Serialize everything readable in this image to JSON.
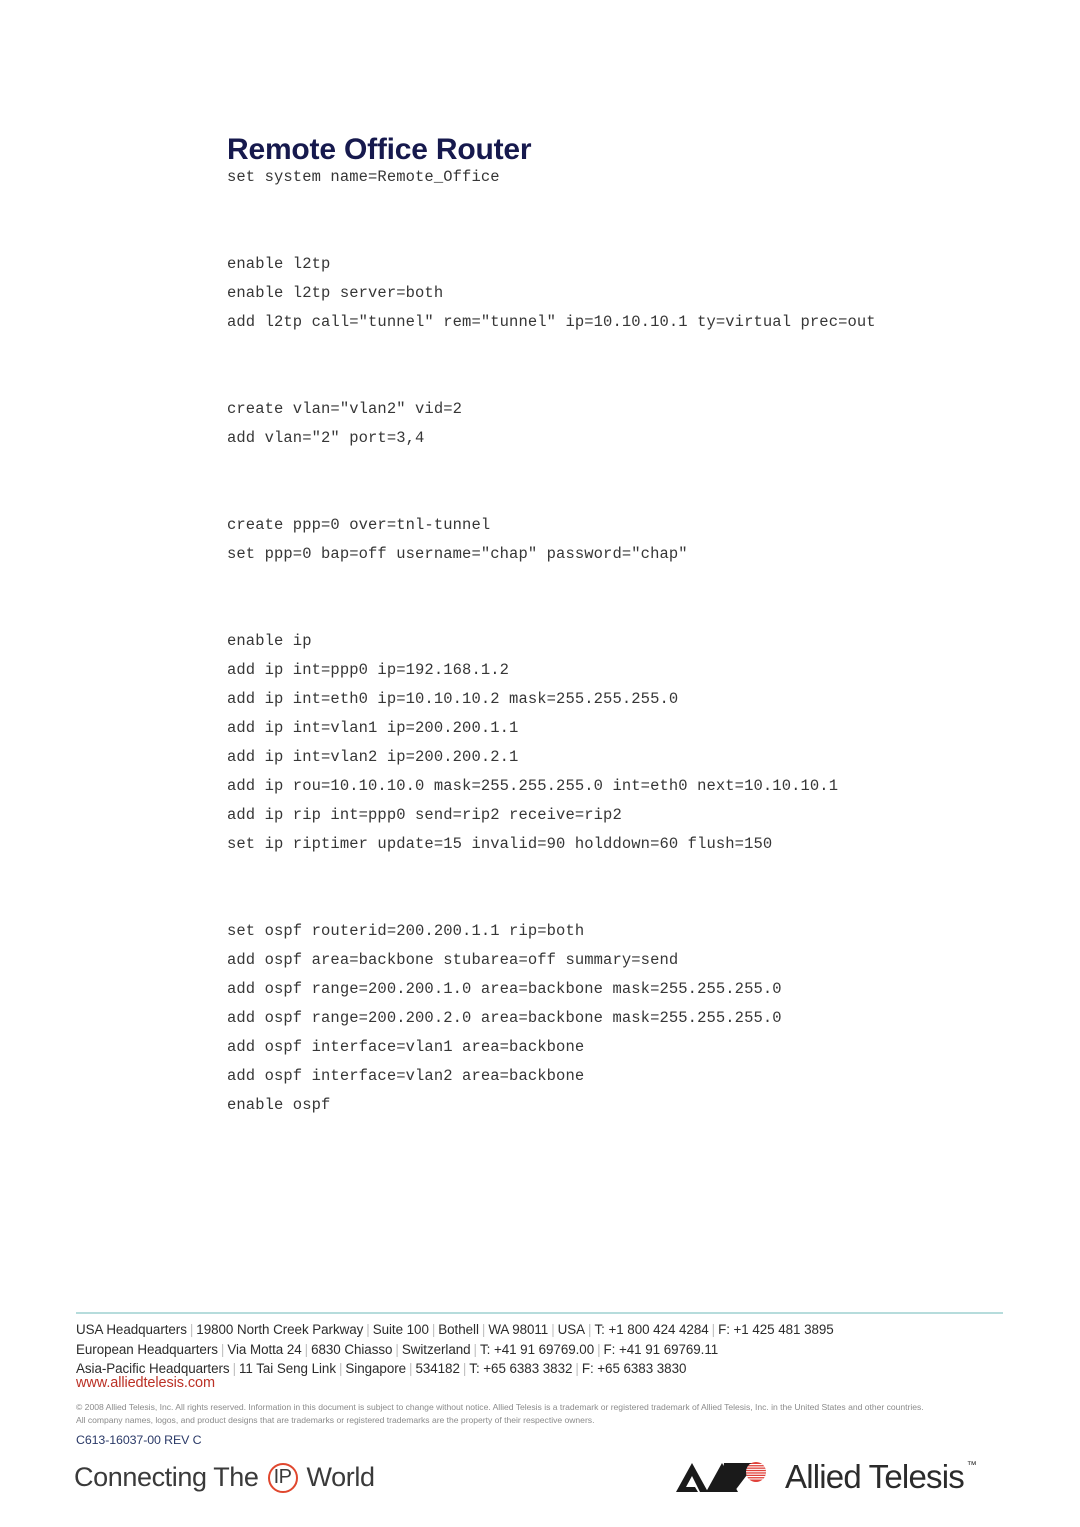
{
  "document": {
    "title": "Remote Office Router",
    "code_lines": [
      "set system name=Remote_Office",
      "",
      "",
      "enable l2tp",
      "enable l2tp server=both",
      "add l2tp call=\"tunnel\" rem=\"tunnel\" ip=10.10.10.1 ty=virtual prec=out",
      "",
      "",
      "create vlan=\"vlan2\" vid=2",
      "add vlan=\"2\" port=3,4",
      "",
      "",
      "create ppp=0 over=tnl-tunnel",
      "set ppp=0 bap=off username=\"chap\" password=\"chap\"",
      "",
      "",
      "enable ip",
      "add ip int=ppp0 ip=192.168.1.2",
      "add ip int=eth0 ip=10.10.10.2 mask=255.255.255.0",
      "add ip int=vlan1 ip=200.200.1.1",
      "add ip int=vlan2 ip=200.200.2.1",
      "add ip rou=10.10.10.0 mask=255.255.255.0 int=eth0 next=10.10.10.1",
      "add ip rip int=ppp0 send=rip2 receive=rip2",
      "set ip riptimer update=15 invalid=90 holddown=60 flush=150",
      "",
      "",
      "set ospf routerid=200.200.1.1 rip=both",
      "add ospf area=backbone stubarea=off summary=send",
      "add ospf range=200.200.1.0 area=backbone mask=255.255.255.0",
      "add ospf range=200.200.2.0 area=backbone mask=255.255.255.0",
      "add ospf interface=vlan1 area=backbone",
      "add ospf interface=vlan2 area=backbone",
      "enable ospf"
    ]
  },
  "footer": {
    "addresses": [
      {
        "parts": [
          "USA Headquarters",
          "19800 North Creek Parkway",
          "Suite 100",
          "Bothell",
          "WA 98011",
          "USA",
          "T: +1 800 424 4284",
          "F: +1 425 481 3895"
        ]
      },
      {
        "parts": [
          "European Headquarters",
          "Via Motta 24",
          "6830 Chiasso",
          "Switzerland",
          "T: +41 91 69769.00",
          "F: +41 91 69769.11"
        ]
      },
      {
        "parts": [
          "Asia-Pacific Headquarters",
          "11 Tai Seng Link",
          "Singapore",
          "534182",
          "T: +65 6383 3832",
          "F: +65 6383 3830"
        ]
      }
    ],
    "url": "www.alliedtelesis.com",
    "legal_line_1": "© 2008 Allied Telesis, Inc. All rights reserved. Information in this document is subject to change without notice.  Allied Telesis is a trademark or registered trademark of Allied Telesis, Inc. in the United States and other countries.",
    "legal_line_2": "All company names, logos, and product designs that are trademarks or registered trademarks are the property of their respective owners.",
    "doc_code": "C613-16037-00 REV C",
    "rule_color": "#b6dcdc",
    "url_color": "#bb3126",
    "doc_code_color": "#2b3a68"
  },
  "branding": {
    "tagline_before": "Connecting The",
    "tagline_badge": "IP",
    "tagline_after": "World",
    "badge_color": "#e0472e",
    "company_name": "Allied Telesis",
    "trademark": "™",
    "mark_color": "#1a1a1a",
    "mark_accent_color": "#e0413a"
  },
  "theme": {
    "title_color": "#16194d",
    "code_color": "#363636",
    "background": "#ffffff"
  }
}
